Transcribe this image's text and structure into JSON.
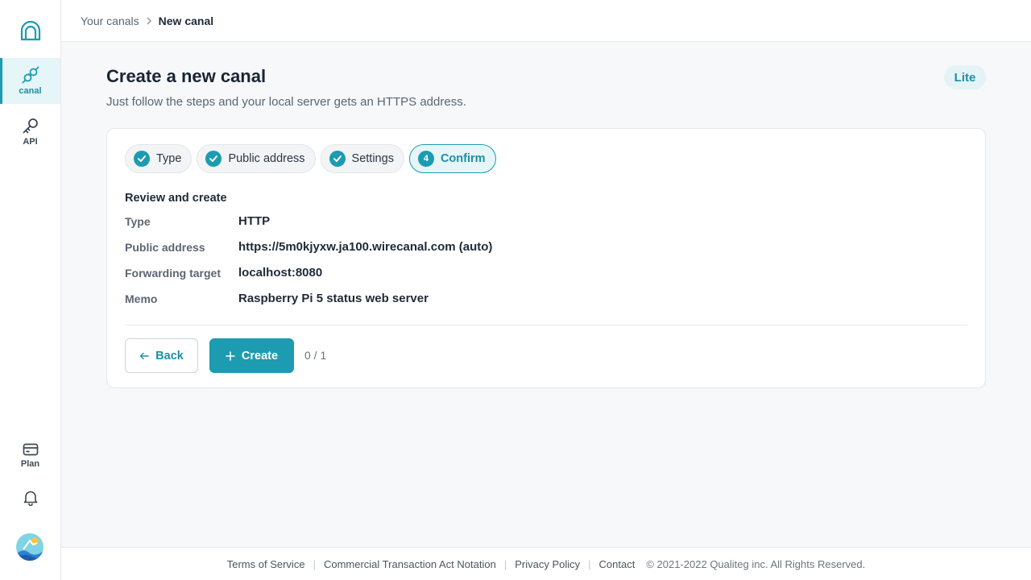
{
  "sidebar": {
    "items": [
      {
        "label": "canal",
        "icon": "plug-icon"
      },
      {
        "label": "API",
        "icon": "key-icon"
      },
      {
        "label": "Plan",
        "icon": "card-icon"
      }
    ]
  },
  "breadcrumb": {
    "parent": "Your canals",
    "current": "New canal"
  },
  "page": {
    "title": "Create a new canal",
    "subtitle": "Just follow the steps and your local server gets an HTTPS address.",
    "plan_badge": "Lite"
  },
  "steps": [
    {
      "label": "Type",
      "done": true
    },
    {
      "label": "Public address",
      "done": true
    },
    {
      "label": "Settings",
      "done": true
    },
    {
      "label": "Confirm",
      "number": "4",
      "current": true
    }
  ],
  "review": {
    "title": "Review and create",
    "rows": [
      {
        "key": "Type",
        "value": "HTTP"
      },
      {
        "key": "Public address",
        "value": "https://5m0kjyxw.ja100.wirecanal.com (auto)"
      },
      {
        "key": "Forwarding target",
        "value": "localhost:8080"
      },
      {
        "key": "Memo",
        "value": "Raspberry Pi 5 status web server"
      }
    ]
  },
  "actions": {
    "back_label": "Back",
    "create_label": "Create",
    "counter": "0 / 1"
  },
  "footer": {
    "links": [
      "Terms of Service",
      "Commercial Transaction Act Notation",
      "Privacy Policy",
      "Contact"
    ],
    "copyright": "© 2021-2022 Qualiteg inc. All Rights Reserved."
  },
  "colors": {
    "accent": "#1d9bb0",
    "accent_light": "#e6f5f7",
    "text": "#1f2a37",
    "muted": "#5b6673"
  }
}
